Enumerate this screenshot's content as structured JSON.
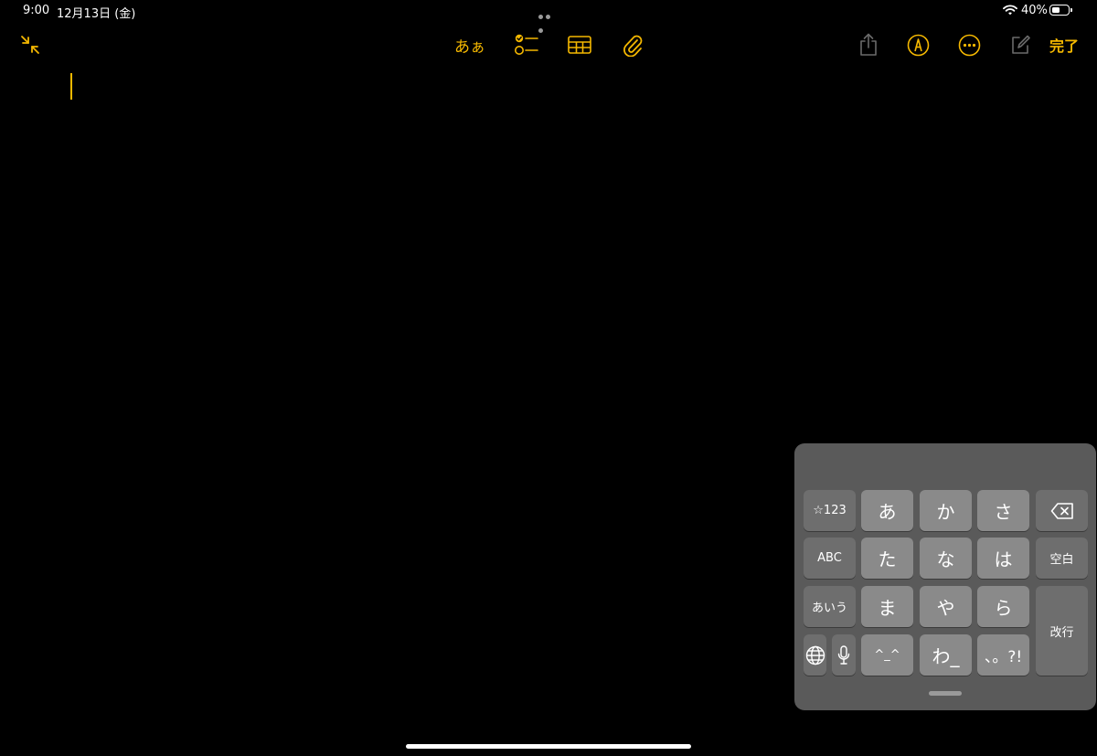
{
  "status_bar": {
    "time": "9:00",
    "date": "12月13日 (金)",
    "battery_percent_label": "40%",
    "battery_level": 0.4
  },
  "toolbar": {
    "format_label": "あぁ",
    "done_label": "完了",
    "icons": [
      "collapse-arrows-icon",
      "checklist-icon",
      "table-icon",
      "paperclip-icon",
      "share-icon",
      "markup-pen-icon",
      "more-ellipsis-icon",
      "compose-icon"
    ],
    "accent_color": "#f5b800"
  },
  "keyboard": {
    "row1": {
      "symbols": "☆123",
      "a": "あ",
      "ka": "か",
      "sa": "さ"
    },
    "row2": {
      "abc": "ABC",
      "ta": "た",
      "na": "な",
      "ha": "は",
      "space": "空白"
    },
    "row3": {
      "kana": "あいう",
      "ma": "ま",
      "ya": "や",
      "ra": "ら",
      "return": "改行"
    },
    "row4": {
      "emoticon": "^_^",
      "wa": "わ_",
      "punct": "、。?!"
    }
  }
}
